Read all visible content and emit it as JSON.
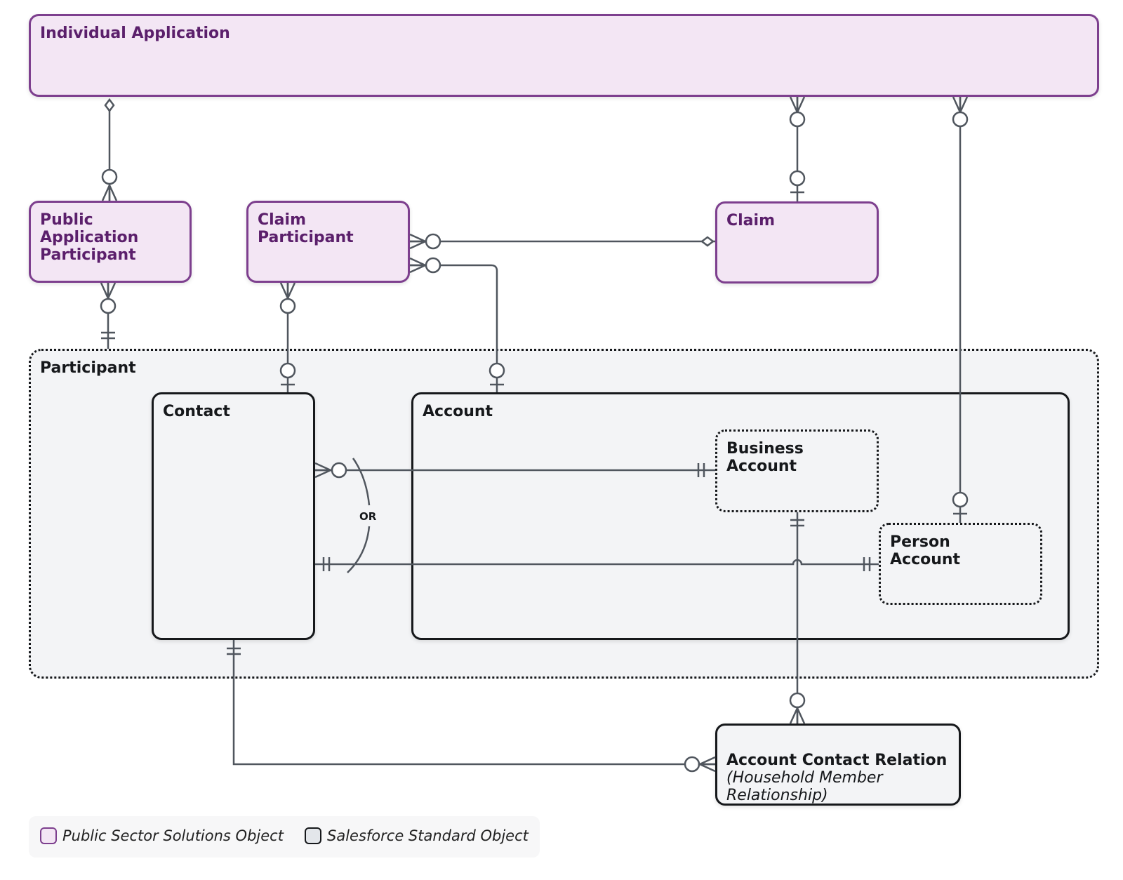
{
  "entities": {
    "individual_application": "Individual Application",
    "public_application_participant": "Public\nApplication\nParticipant",
    "claim_participant": "Claim\nParticipant",
    "claim": "Claim",
    "participant": "Participant",
    "contact": "Contact",
    "account": "Account",
    "business_account": "Business\nAccount",
    "person_account": "Person\nAccount",
    "account_contact_relation": "Account Contact Relation",
    "account_contact_relation_sub": "(Household Member\nRelationship)"
  },
  "or_label": "OR",
  "legend": {
    "pss": "Public Sector Solutions Object",
    "std": "Salesforce Standard Object"
  },
  "colors": {
    "pss_border": "#7d3f8e",
    "pss_fill": "#f3e6f4",
    "pss_text": "#5b1f6b",
    "std_border": "#16181b",
    "std_fill": "#f3f4f6",
    "connector": "#50565e"
  }
}
